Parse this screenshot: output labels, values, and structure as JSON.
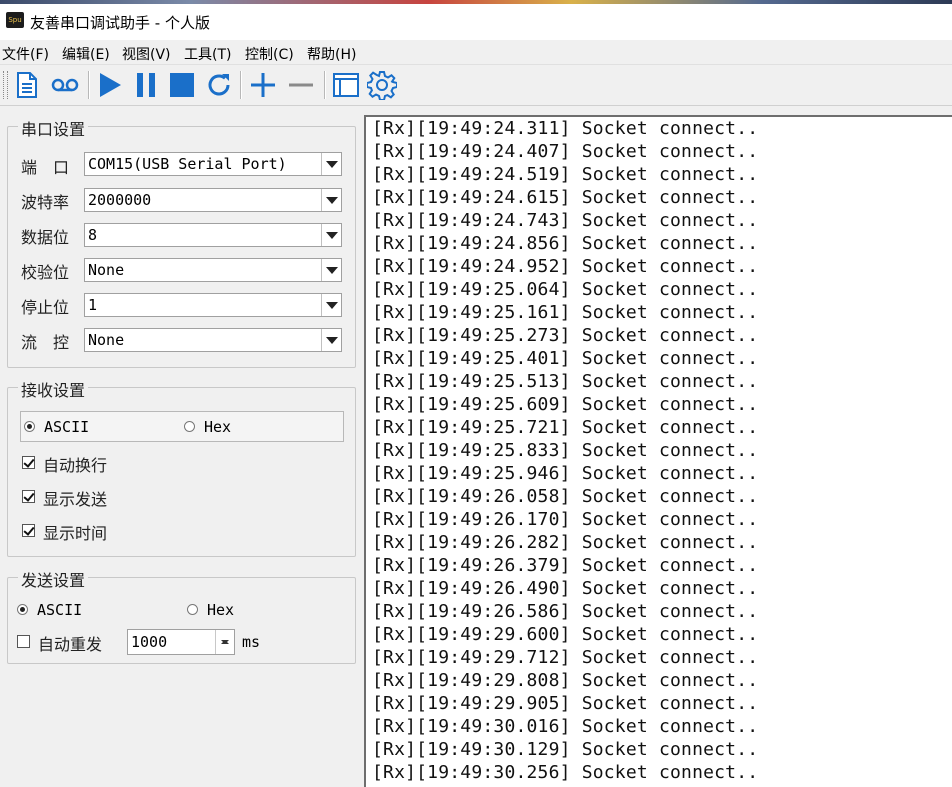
{
  "window": {
    "title": "友善串口调试助手 - 个人版",
    "app_icon_text": "Spu"
  },
  "menu": [
    "文件(F)",
    "编辑(E)",
    "视图(V)",
    "工具(T)",
    "控制(C)",
    "帮助(H)"
  ],
  "toolbar": {
    "icons": [
      "document-icon",
      "record-icon",
      "play-icon",
      "pause-icon",
      "stop-icon",
      "refresh-icon",
      "plus-icon",
      "minus-icon",
      "window-icon",
      "gear-icon"
    ],
    "accent": "#1a6fc9"
  },
  "serial": {
    "title": "串口设置",
    "fields": [
      {
        "label": "端　口",
        "value": "COM15(USB Serial Port)"
      },
      {
        "label": "波特率",
        "value": "2000000"
      },
      {
        "label": "数据位",
        "value": "8"
      },
      {
        "label": "校验位",
        "value": "None"
      },
      {
        "label": "停止位",
        "value": "1"
      },
      {
        "label": "流　控",
        "value": "None"
      }
    ]
  },
  "receive": {
    "title": "接收设置",
    "mode_ascii": "ASCII",
    "mode_hex": "Hex",
    "selected": "ASCII",
    "options": [
      {
        "label": "自动换行",
        "checked": true
      },
      {
        "label": "显示发送",
        "checked": true
      },
      {
        "label": "显示时间",
        "checked": true
      }
    ]
  },
  "send": {
    "title": "发送设置",
    "mode_ascii": "ASCII",
    "mode_hex": "Hex",
    "selected": "ASCII",
    "auto_resend_label": "自动重发",
    "auto_resend_checked": false,
    "interval": "1000",
    "unit": "ms"
  },
  "log": [
    "[Rx][19:49:24.311] Socket connect..",
    "[Rx][19:49:24.407] Socket connect..",
    "[Rx][19:49:24.519] Socket connect..",
    "[Rx][19:49:24.615] Socket connect..",
    "[Rx][19:49:24.743] Socket connect..",
    "[Rx][19:49:24.856] Socket connect..",
    "[Rx][19:49:24.952] Socket connect..",
    "[Rx][19:49:25.064] Socket connect..",
    "[Rx][19:49:25.161] Socket connect..",
    "[Rx][19:49:25.273] Socket connect..",
    "[Rx][19:49:25.401] Socket connect..",
    "[Rx][19:49:25.513] Socket connect..",
    "[Rx][19:49:25.609] Socket connect..",
    "[Rx][19:49:25.721] Socket connect..",
    "[Rx][19:49:25.833] Socket connect..",
    "[Rx][19:49:25.946] Socket connect..",
    "[Rx][19:49:26.058] Socket connect..",
    "[Rx][19:49:26.170] Socket connect..",
    "[Rx][19:49:26.282] Socket connect..",
    "[Rx][19:49:26.379] Socket connect..",
    "[Rx][19:49:26.490] Socket connect..",
    "[Rx][19:49:26.586] Socket connect..",
    "[Rx][19:49:29.600] Socket connect..",
    "[Rx][19:49:29.712] Socket connect..",
    "[Rx][19:49:29.808] Socket connect..",
    "[Rx][19:49:29.905] Socket connect..",
    "[Rx][19:49:30.016] Socket connect..",
    "[Rx][19:49:30.129] Socket connect..",
    "[Rx][19:49:30.256] Socket connect.."
  ]
}
